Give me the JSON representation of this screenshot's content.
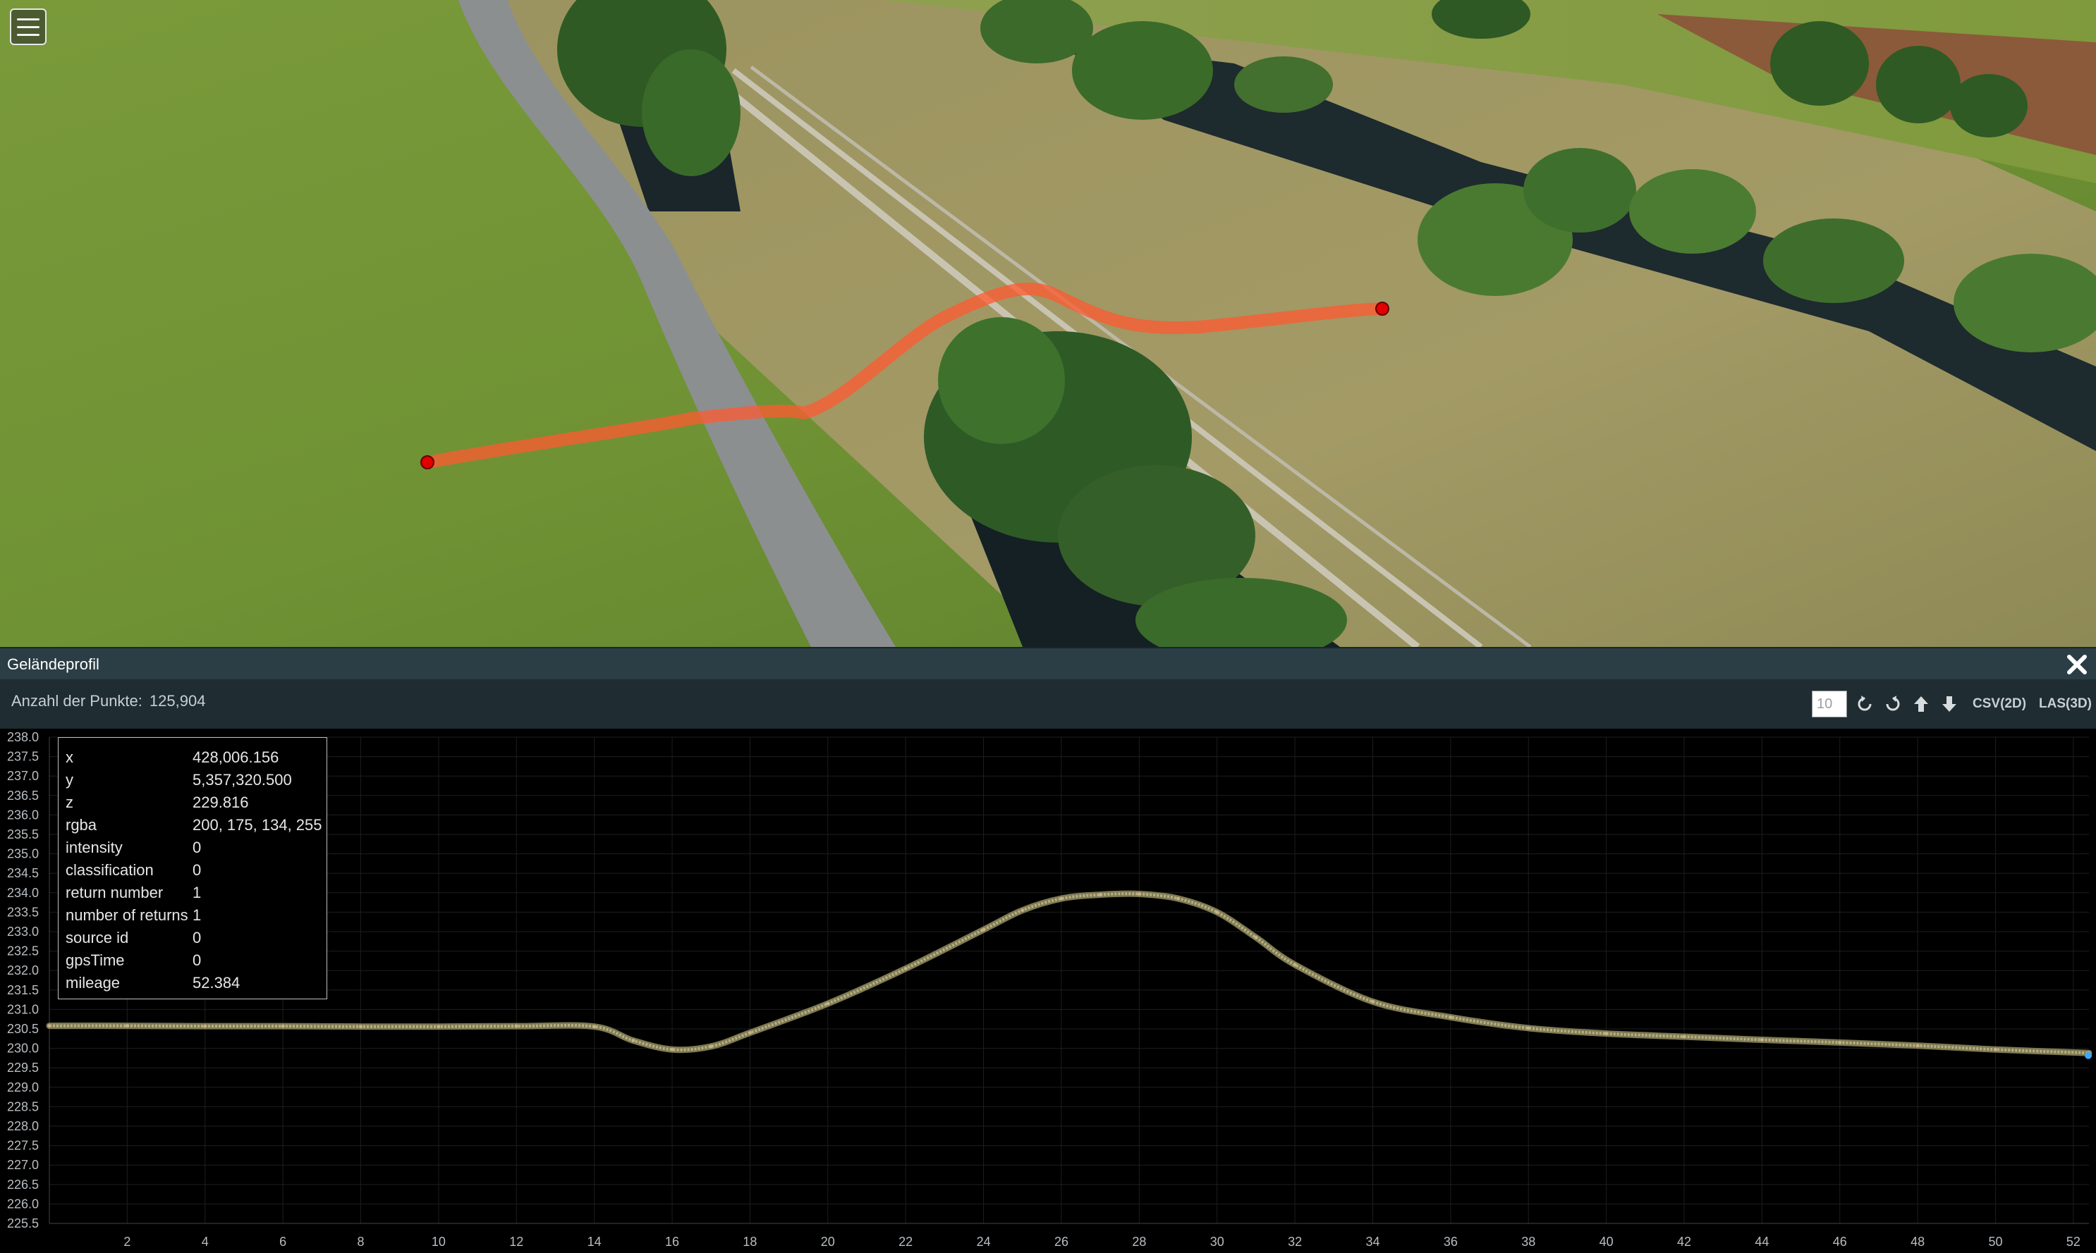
{
  "panel": {
    "title": "Geländeprofil",
    "point_count_label": "Anzahl der Punkte:",
    "point_count_value": "125,904"
  },
  "toolbar": {
    "width_value": "10",
    "icons": [
      "rotate-ccw-icon",
      "rotate-cw-icon",
      "move-up-icon",
      "move-down-icon"
    ],
    "csv_label": "CSV(2D)",
    "las_label": "LAS(3D)"
  },
  "info": [
    {
      "key": "x",
      "value": "428,006.156"
    },
    {
      "key": "y",
      "value": "5,357,320.500"
    },
    {
      "key": "z",
      "value": "229.816"
    },
    {
      "key": "rgba",
      "value": "200, 175, 134, 255"
    },
    {
      "key": "intensity",
      "value": "0"
    },
    {
      "key": "classification",
      "value": "0"
    },
    {
      "key": "return number",
      "value": "1"
    },
    {
      "key": "number of returns",
      "value": "1"
    },
    {
      "key": "source id",
      "value": "0"
    },
    {
      "key": "gpsTime",
      "value": "0"
    },
    {
      "key": "mileage",
      "value": "52.384"
    }
  ],
  "chart_data": {
    "type": "scatter",
    "title": "",
    "xlabel": "",
    "ylabel": "",
    "xlim": [
      0,
      52.4
    ],
    "ylim": [
      225.5,
      238.0
    ],
    "x_ticks": [
      2,
      4,
      6,
      8,
      10,
      12,
      14,
      16,
      18,
      20,
      22,
      24,
      26,
      28,
      30,
      32,
      34,
      36,
      38,
      40,
      42,
      44,
      46,
      48,
      50,
      52
    ],
    "y_ticks": [
      225.5,
      226.0,
      226.5,
      227.0,
      227.5,
      228.0,
      228.5,
      229.0,
      229.5,
      230.0,
      230.5,
      231.0,
      231.5,
      232.0,
      232.5,
      233.0,
      233.5,
      234.0,
      234.5,
      235.0,
      235.5,
      236.0,
      236.5,
      237.0,
      237.5,
      238.0
    ],
    "grid": true,
    "series": [
      {
        "x": [
          0,
          2,
          4,
          6,
          8,
          10,
          12,
          14,
          15,
          16,
          17,
          18,
          20,
          22,
          24,
          25,
          26,
          27,
          28,
          29,
          30,
          31,
          32,
          34,
          36,
          38,
          40,
          42,
          44,
          46,
          48,
          50,
          52.4
        ],
        "y": [
          230.58,
          230.58,
          230.57,
          230.57,
          230.56,
          230.56,
          230.57,
          230.56,
          230.2,
          229.97,
          230.05,
          230.4,
          231.15,
          232.05,
          233.05,
          233.55,
          233.85,
          233.95,
          233.97,
          233.85,
          233.5,
          232.85,
          232.15,
          231.2,
          230.8,
          230.52,
          230.38,
          230.3,
          230.22,
          230.15,
          230.07,
          229.97,
          229.88
        ]
      }
    ]
  }
}
